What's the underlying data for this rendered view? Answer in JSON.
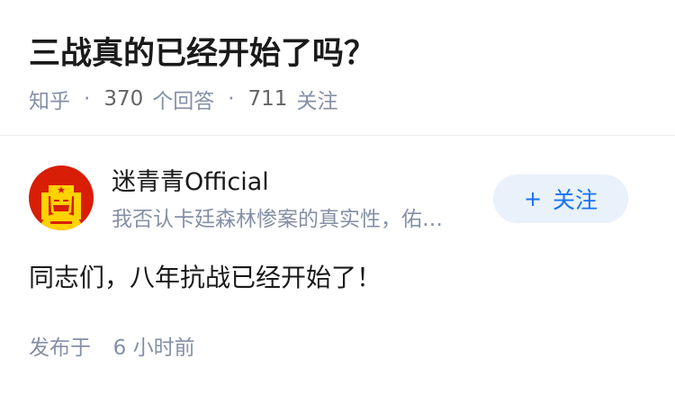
{
  "question": {
    "title": "三战真的已经开始了吗？",
    "source": "知乎",
    "separator": "·",
    "answer_count": "370",
    "answer_label": "个回答",
    "follower_count": "711",
    "follower_label": "关注"
  },
  "answer": {
    "author_name": "迷青青Official",
    "author_bio": "我否认卡廷森林惨案的真实性，佑…",
    "follow_button": {
      "icon": "plus-icon",
      "icon_glyph": "+",
      "label": "关注"
    },
    "content": "同志们，八年抗战已经开始了！",
    "published_label": "发布于",
    "published_time": "6 小时前"
  },
  "colors": {
    "title": "#1a1a1a",
    "meta": "#8590a6",
    "accent": "#1772f6",
    "follow_bg": "#e9f1fa",
    "avatar_red": "#d81e06",
    "avatar_yellow": "#ffd200"
  }
}
